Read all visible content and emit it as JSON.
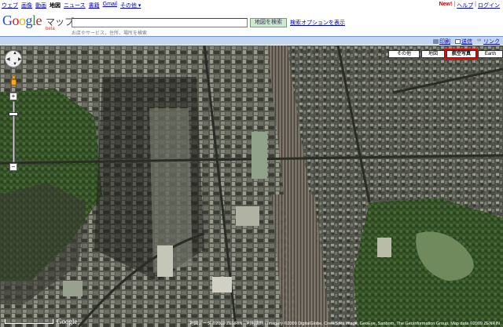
{
  "gbar": {
    "links": [
      "ウェブ",
      "画像",
      "動画",
      "地図",
      "ニュース",
      "書籍",
      "Gmail"
    ],
    "active_index": 3,
    "more": "その他 ▾",
    "new": "New!",
    "help": "ヘルプ",
    "login": "ログイン"
  },
  "header": {
    "product": "マップ",
    "beta": "beta",
    "search_value": "",
    "search_button": "地図を検索",
    "search_options": "検索オプションを表示",
    "search_hint": "お店やサービス、住所、場所を検索"
  },
  "toolbar": {
    "print": "印刷",
    "send": "送信",
    "link": "リンク"
  },
  "map_types": [
    {
      "label": "その他",
      "selected": false
    },
    {
      "label": "地図",
      "selected": false
    },
    {
      "label": "航空写真",
      "selected": true
    },
    {
      "label": "Earth",
      "selected": false
    }
  ],
  "nav": {
    "zoom_in": "+",
    "zoom_out": "−"
  },
  "footer": {
    "copyright": "地図データ ©2009 ZENRIN - 利用規約 / Imagery ©2009 DigitalGlobe, Cnes/Spot Image, GeoEye, Sanborn, The GeoInformation Group, Map data ©2009 ZENRIN"
  }
}
